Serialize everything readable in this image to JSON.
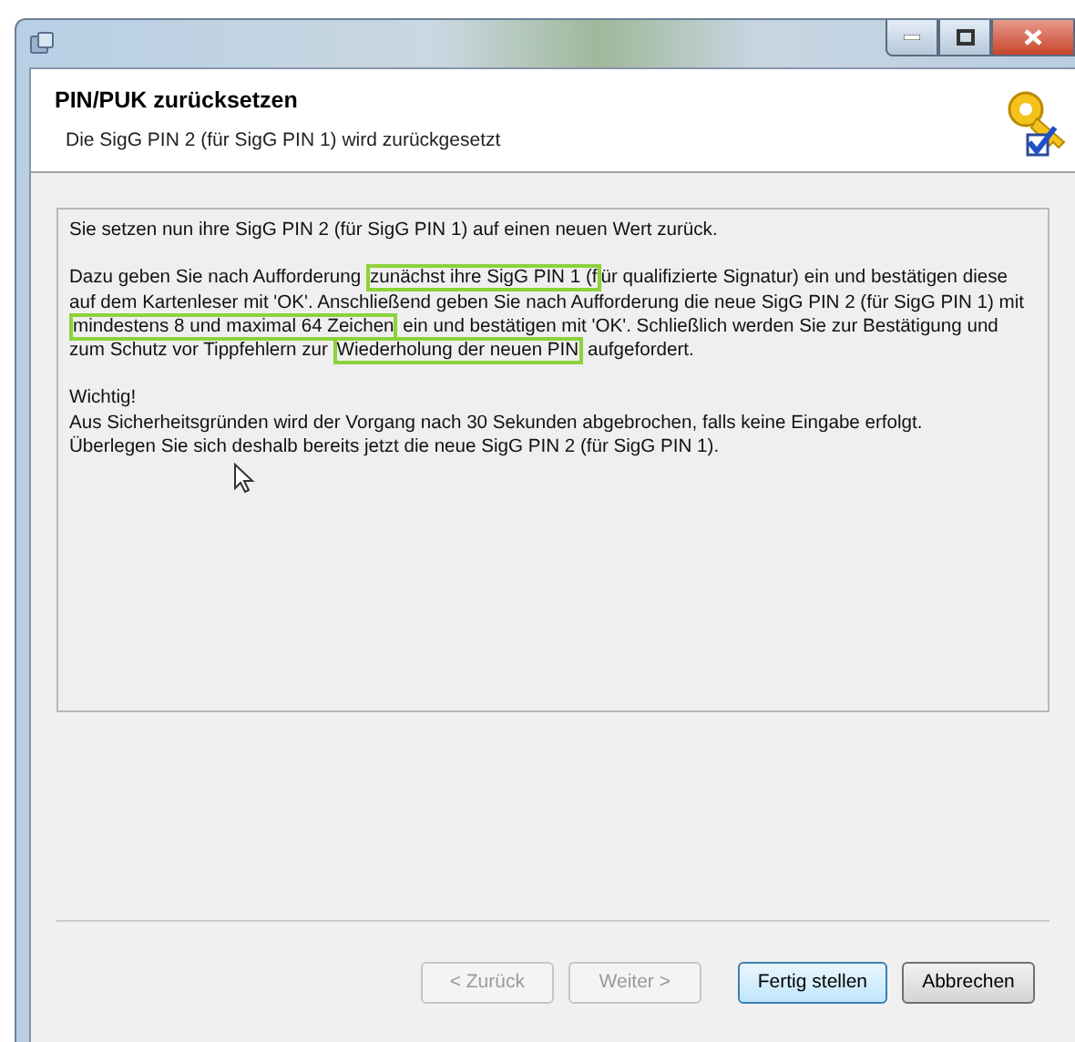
{
  "window": {
    "controls": [
      {
        "kind": "minimize"
      },
      {
        "kind": "maximize"
      },
      {
        "kind": "close"
      }
    ]
  },
  "header": {
    "title": "PIN/PUK zurücksetzen",
    "subtitle": "Die SigG PIN 2 (für SigG PIN 1) wird zurückgesetzt"
  },
  "content": {
    "paragraphs": [
      [
        {
          "text": "Sie setzen nun ihre SigG PIN 2 (für SigG PIN 1) auf einen neuen Wert zurück.",
          "highlighted": false
        }
      ],
      [
        {
          "text": "Dazu geben Sie nach Aufforderung ",
          "highlighted": false
        },
        {
          "text": "zunächst ihre SigG PIN 1 (f",
          "highlighted": true
        },
        {
          "text": "ür qualifizierte Signatur) ein und bestätigen diese auf dem Kartenleser mit 'OK'. Anschließend geben Sie nach Aufforderung die neue SigG PIN 2 (für SigG PIN 1) mit ",
          "highlighted": false
        },
        {
          "text": "mindestens 8 und maximal 64 Zeichen",
          "highlighted": true
        },
        {
          "text": " ein und bestätigen mit 'OK'. Schließlich werden Sie zur Bestätigung und zum Schutz vor Tippfehlern zur ",
          "highlighted": false
        },
        {
          "text": "Wiederholung der neuen PIN",
          "highlighted": true
        },
        {
          "text": " aufgefordert.",
          "highlighted": false
        }
      ],
      [
        {
          "text": "Wichtig!",
          "highlighted": false
        }
      ],
      [
        {
          "text": "Aus Sicherheitsgründen wird der Vorgang nach 30 Sekunden abgebrochen, falls keine Eingabe erfolgt.",
          "highlighted": false
        }
      ],
      [
        {
          "text": "Überlegen Sie sich deshalb bereits jetzt die neue SigG PIN 2 (für SigG PIN 1).",
          "highlighted": false
        }
      ]
    ]
  },
  "buttons": [
    {
      "label": "< Zurück",
      "disabled": true,
      "default": false
    },
    {
      "label": "Weiter >",
      "disabled": true,
      "default": false
    },
    {
      "label": "Fertig stellen",
      "disabled": false,
      "default": true
    },
    {
      "label": "Abbrechen",
      "disabled": false,
      "default": false
    }
  ]
}
